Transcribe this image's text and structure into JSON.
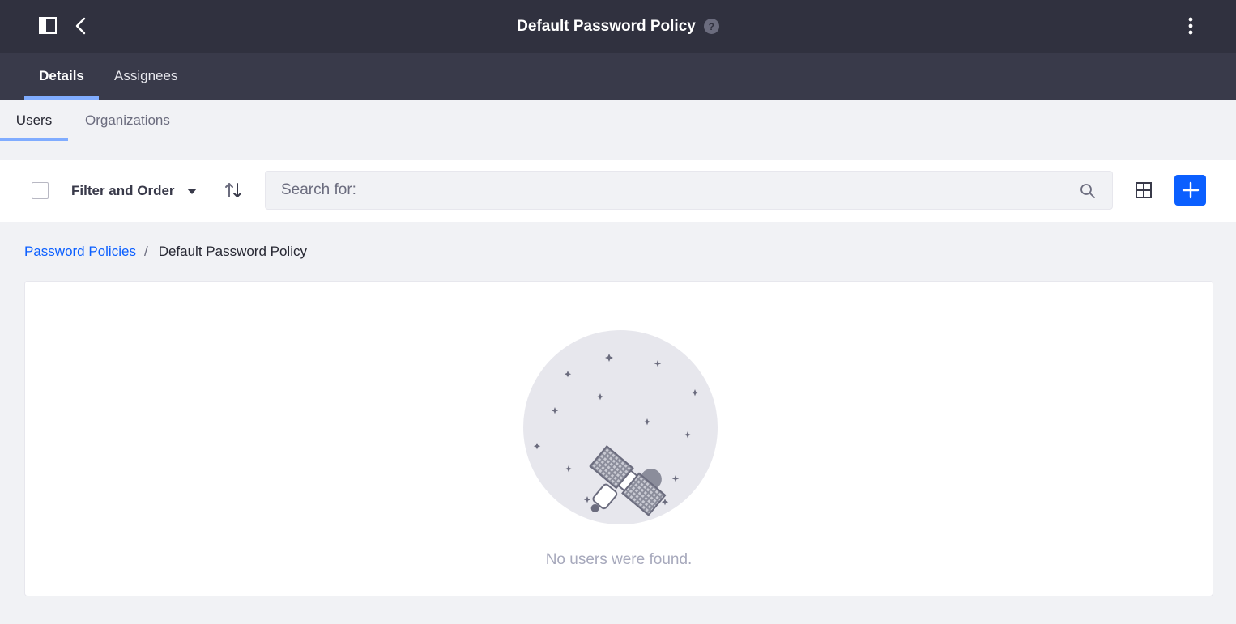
{
  "header": {
    "title": "Default Password Policy",
    "help_symbol": "?"
  },
  "nav_tabs": [
    {
      "label": "Details",
      "active": true
    },
    {
      "label": "Assignees",
      "active": false
    }
  ],
  "sub_tabs": [
    {
      "label": "Users",
      "active": true
    },
    {
      "label": "Organizations",
      "active": false
    }
  ],
  "toolbar": {
    "filter_label": "Filter and Order",
    "search_placeholder": "Search for:",
    "search_value": ""
  },
  "breadcrumb": {
    "parent": "Password Policies",
    "separator": "/",
    "current": "Default Password Policy"
  },
  "empty_state": {
    "message": "No users were found."
  },
  "colors": {
    "topbar": "#30313f",
    "navbar": "#393a4a",
    "accent": "#0b5fff",
    "tab_indicator": "#80acff"
  },
  "icons": [
    "sidebar-toggle-icon",
    "back-chevron-icon",
    "help-icon",
    "kebab-menu-icon",
    "caret-down-icon",
    "sort-arrows-icon",
    "search-icon",
    "grid-view-icon",
    "plus-icon",
    "satellite-illustration"
  ]
}
